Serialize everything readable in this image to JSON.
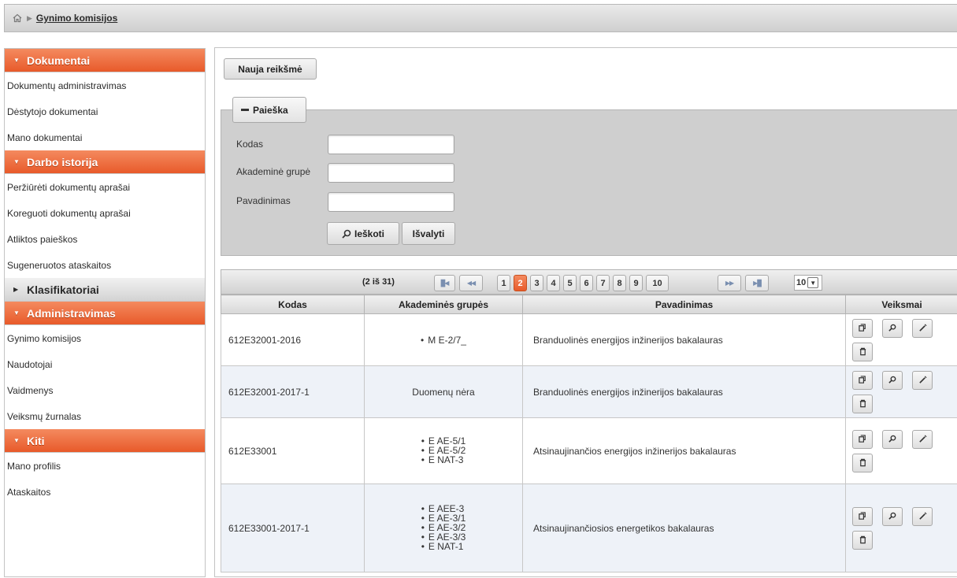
{
  "breadcrumb": {
    "current": "Gynimo komisijos"
  },
  "sidebar": {
    "sections": [
      {
        "title": "Dokumentai",
        "open": true,
        "items": [
          "Dokumentų administravimas",
          "Dėstytojo dokumentai",
          "Mano dokumentai"
        ]
      },
      {
        "title": "Darbo istorija",
        "open": true,
        "items": [
          "Peržiūrėti dokumentų aprašai",
          "Koreguoti dokumentų aprašai",
          "Atliktos paieškos",
          "Sugeneruotos ataskaitos"
        ]
      },
      {
        "title": "Klasifikatoriai",
        "open": false,
        "items": []
      },
      {
        "title": "Administravimas",
        "open": true,
        "items": [
          "Gynimo komisijos",
          "Naudotojai",
          "Vaidmenys",
          "Veiksmų žurnalas"
        ]
      },
      {
        "title": "Kiti",
        "open": true,
        "items": [
          "Mano profilis",
          "Ataskaitos"
        ]
      }
    ]
  },
  "main": {
    "new_button": "Nauja reikšmė",
    "search": {
      "legend": "Paieška",
      "fields": [
        "Kodas",
        "Akademinė grupė",
        "Pavadinimas"
      ],
      "search_button": "Ieškoti",
      "clear_button": "Išvalyti"
    },
    "pager": {
      "count": "(2 iš 31)",
      "pages": [
        "1",
        "2",
        "3",
        "4",
        "5",
        "6",
        "7",
        "8",
        "9",
        "10"
      ],
      "active_page": "2",
      "rows_per_page": "10"
    },
    "table": {
      "headers": [
        "Kodas",
        "Akademinės grupės",
        "Pavadinimas",
        "Veiksmai"
      ],
      "rows": [
        {
          "kodas": "612E32001-2016",
          "groups": [
            "M E-2/7_"
          ],
          "groups_text": "",
          "name": "Branduolinės energijos inžinerijos bakalauras"
        },
        {
          "kodas": "612E32001-2017-1",
          "groups": [],
          "groups_text": "Duomenų nėra",
          "name": "Branduolinės energijos inžinerijos bakalauras"
        },
        {
          "kodas": "612E33001",
          "groups": [
            "E AE-5/1",
            "E AE-5/2",
            "E NAT-3"
          ],
          "groups_text": "",
          "name": "Atsinaujinančios energijos inžinerijos bakalauras"
        },
        {
          "kodas": "612E33001-2017-1",
          "groups": [
            "E AEE-3",
            "E AE-3/1",
            "E AE-3/2",
            "E AE-3/3",
            "E NAT-1"
          ],
          "groups_text": "",
          "name": "Atsinaujinančiosios energetikos bakalauras"
        }
      ]
    }
  }
}
